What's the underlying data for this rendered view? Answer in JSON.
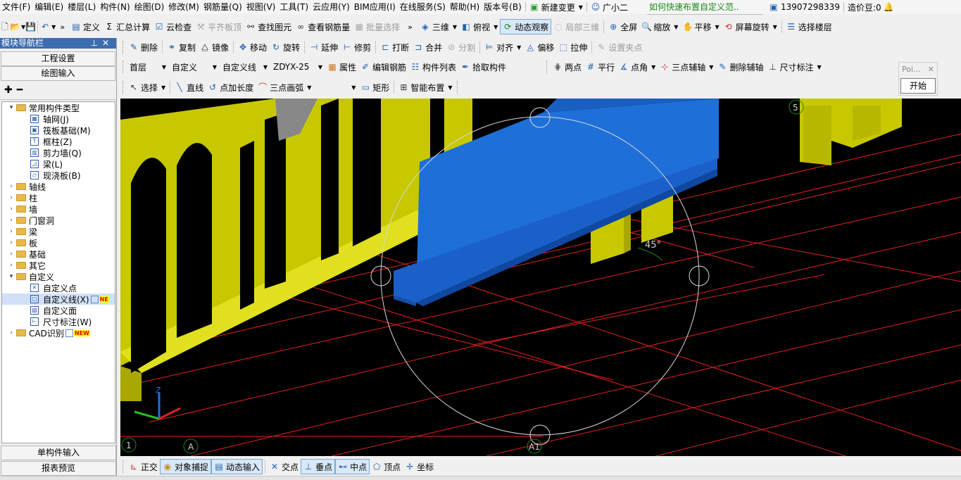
{
  "menu": [
    "文件(F)",
    "编辑(E)",
    "楼层(L)",
    "构件(N)",
    "绘图(D)",
    "修改(M)",
    "钢筋量(Q)",
    "视图(V)",
    "工具(T)",
    "云应用(Y)",
    "BIM应用(I)",
    "在线服务(S)",
    "帮助(H)",
    "版本号(B)"
  ],
  "menu_right": {
    "new_change": "新建变更",
    "assistant": "广小二",
    "tip": "如何快速布置自定义范..",
    "phone": "13907298339",
    "beans": "造价豆:0"
  },
  "toolbar1": {
    "define": "定义",
    "sum": "汇总计算",
    "cloud_check": "云检查",
    "level_slab": "平齐板顶",
    "find": "查找图元",
    "view_rebar": "查看钢筋量",
    "batch_select": "批量选择",
    "view3d": "三维",
    "top_view": "俯视",
    "dyn_view": "动态观察",
    "local3d": "局部三维",
    "fullscreen": "全屏",
    "zoom": "缩放",
    "pan": "平移",
    "screen_rotate": "屏幕旋转",
    "select_floor": "选择楼层"
  },
  "toolbar2": {
    "delete": "删除",
    "copy": "复制",
    "mirror": "镜像",
    "move": "移动",
    "rotate": "旋转",
    "extend": "延伸",
    "trim": "修剪",
    "break": "打断",
    "merge": "合并",
    "split": "分割",
    "align": "对齐",
    "offset": "偏移",
    "stretch": "拉伸",
    "set_grip": "设置夹点"
  },
  "toolbar3": {
    "floor": "首层",
    "category": "自定义",
    "type": "自定义线",
    "component": "ZDYX-25",
    "property": "属性",
    "edit_rebar": "编辑钢筋",
    "comp_list": "构件列表",
    "pick": "拾取构件",
    "two_pts": "两点",
    "parallel": "平行",
    "pt_angle": "点角",
    "three_pt_axis": "三点辅轴",
    "del_axis": "删除辅轴",
    "dim": "尺寸标注"
  },
  "toolbar4": {
    "select": "选择",
    "line": "直线",
    "pt_length": "点加长度",
    "arc": "三点画弧",
    "rect": "矩形",
    "smart": "智能布置"
  },
  "popup": {
    "title": "Poi...",
    "start": "开始"
  },
  "nav": {
    "title": "模块导航栏",
    "project_settings": "工程设置",
    "draw_input": "绘图输入",
    "single_input": "单构件输入",
    "report": "报表预览",
    "tree": [
      {
        "label": "常用构件类型",
        "level": 0,
        "expanded": true,
        "folder": true
      },
      {
        "label": "轴网(J)",
        "level": 1,
        "icon": "grid-icon"
      },
      {
        "label": "筏板基础(M)",
        "level": 1,
        "icon": "raft-icon"
      },
      {
        "label": "框柱(Z)",
        "level": 1,
        "icon": "column-icon"
      },
      {
        "label": "剪力墙(Q)",
        "level": 1,
        "icon": "shear-wall-icon"
      },
      {
        "label": "梁(L)",
        "level": 1,
        "icon": "beam-icon"
      },
      {
        "label": "现浇板(B)",
        "level": 1,
        "icon": "slab-icon"
      },
      {
        "label": "轴线",
        "level": 0,
        "folder": true
      },
      {
        "label": "柱",
        "level": 0,
        "folder": true
      },
      {
        "label": "墙",
        "level": 0,
        "folder": true
      },
      {
        "label": "门窗洞",
        "level": 0,
        "folder": true
      },
      {
        "label": "梁",
        "level": 0,
        "folder": true
      },
      {
        "label": "板",
        "level": 0,
        "folder": true
      },
      {
        "label": "基础",
        "level": 0,
        "folder": true
      },
      {
        "label": "其它",
        "level": 0,
        "folder": true
      },
      {
        "label": "自定义",
        "level": 0,
        "expanded": true,
        "folder": true
      },
      {
        "label": "自定义点",
        "level": 1,
        "icon": "custom-point-icon"
      },
      {
        "label": "自定义线(X)",
        "level": 1,
        "icon": "custom-line-icon",
        "selected": true,
        "badge": "NE"
      },
      {
        "label": "自定义面",
        "level": 1,
        "icon": "custom-face-icon"
      },
      {
        "label": "尺寸标注(W)",
        "level": 1,
        "icon": "dimension-icon"
      },
      {
        "label": "CAD识别",
        "level": 0,
        "folder": true,
        "badge": "NEW"
      }
    ]
  },
  "viewport": {
    "angle": "45°",
    "labels": [
      "1",
      "A",
      "A1",
      "5"
    ],
    "axis": [
      "Z"
    ]
  },
  "status": {
    "ortho": "正交",
    "snap": "对象捕捉",
    "dyn_input": "动态输入",
    "intersect": "交点",
    "perp": "垂点",
    "mid": "中点",
    "vertex": "顶点",
    "coord": "坐标"
  }
}
